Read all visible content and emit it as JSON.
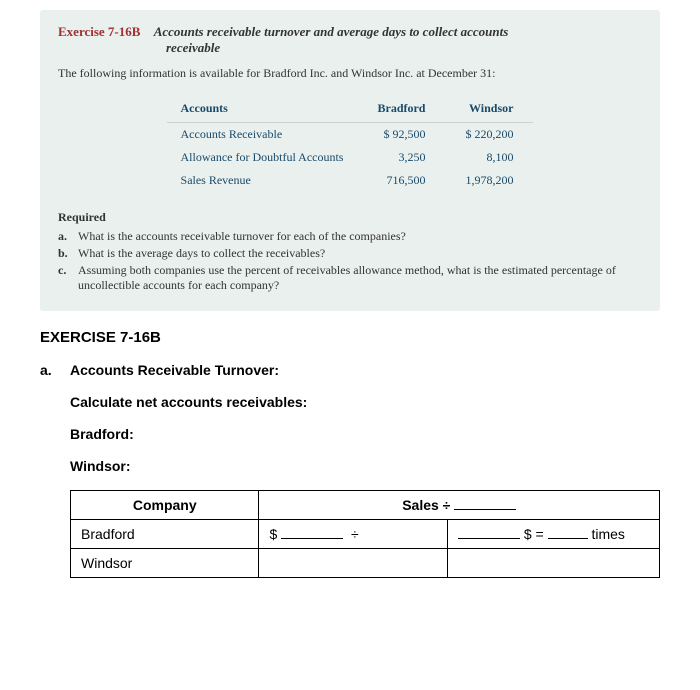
{
  "exercise": {
    "num": "Exercise 7-16B",
    "subtitle1": "Accounts receivable turnover and average days to collect accounts",
    "subtitle2": "receivable",
    "intro": "The following information is available for Bradford Inc. and Windsor Inc. at December 31:"
  },
  "table": {
    "col0": "Accounts",
    "col1": "Bradford",
    "col2": "Windsor",
    "rows": [
      {
        "label": "Accounts Receivable",
        "c1": "$ 92,500",
        "c2": "$ 220,200"
      },
      {
        "label": "Allowance for Doubtful Accounts",
        "c1": "3,250",
        "c2": "8,100"
      },
      {
        "label": "Sales Revenue",
        "c1": "716,500",
        "c2": "1,978,200"
      }
    ]
  },
  "required": {
    "heading": "Required",
    "items": [
      {
        "l": "a.",
        "t": "What is the accounts receivable turnover for each of the companies?"
      },
      {
        "l": "b.",
        "t": "What is the average days to collect the receivables?"
      },
      {
        "l": "c.",
        "t": "Assuming both companies use the percent of receivables allowance method, what is the estimated percentage of uncollectible accounts for each company?"
      }
    ]
  },
  "worksheet": {
    "title": "EXERCISE 7-16B",
    "part_a_letter": "a.",
    "part_a_heading": "Accounts Receivable Turnover:",
    "calc_label": "Calculate net accounts receivables:",
    "bradford": "Bradford:",
    "windsor": "Windsor:",
    "calc_table": {
      "h1": "Company",
      "h2": "Sales ÷",
      "r1_company": "Bradford",
      "r1_dollar": "$",
      "r1_div": "÷",
      "r1_eq": "$ =",
      "r1_times": "times",
      "r2_company": "Windsor"
    }
  }
}
